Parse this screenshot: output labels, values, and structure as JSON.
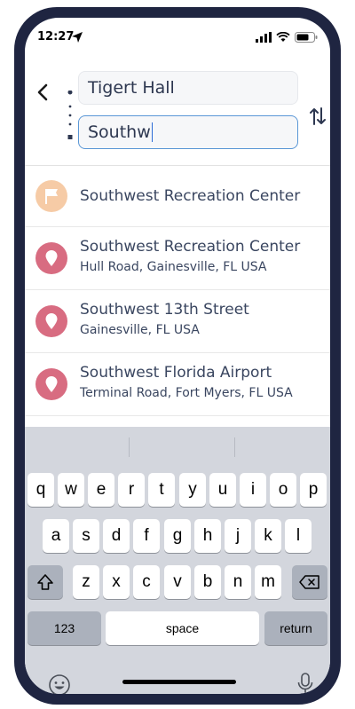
{
  "status": {
    "time": "12:27"
  },
  "route": {
    "from_value": "Tigert Hall",
    "to_value": "Southw"
  },
  "results": [
    {
      "title": "Southwest Recreation Center",
      "subtitle": "",
      "icon": "flag-icon"
    },
    {
      "title": "Southwest Recreation Center",
      "subtitle": "Hull Road, Gainesville, FL USA",
      "icon": "location-pin-icon"
    },
    {
      "title": "Southwest 13th Street",
      "subtitle": "Gainesville, FL USA",
      "icon": "location-pin-icon"
    },
    {
      "title": "Southwest Florida Airport",
      "subtitle": "Terminal Road, Fort Myers, FL USA",
      "icon": "location-pin-icon"
    }
  ],
  "keyboard": {
    "row1": [
      "q",
      "w",
      "e",
      "r",
      "t",
      "y",
      "u",
      "i",
      "o",
      "p"
    ],
    "row2": [
      "a",
      "s",
      "d",
      "f",
      "g",
      "h",
      "j",
      "k",
      "l"
    ],
    "row3": [
      "z",
      "x",
      "c",
      "v",
      "b",
      "n",
      "m"
    ],
    "numbers_label": "123",
    "space_label": "space",
    "return_label": "return"
  },
  "colors": {
    "accent": "#5a97d6",
    "pin": "#d86c81",
    "flag": "#f6cba6",
    "frame": "#1f2541"
  }
}
